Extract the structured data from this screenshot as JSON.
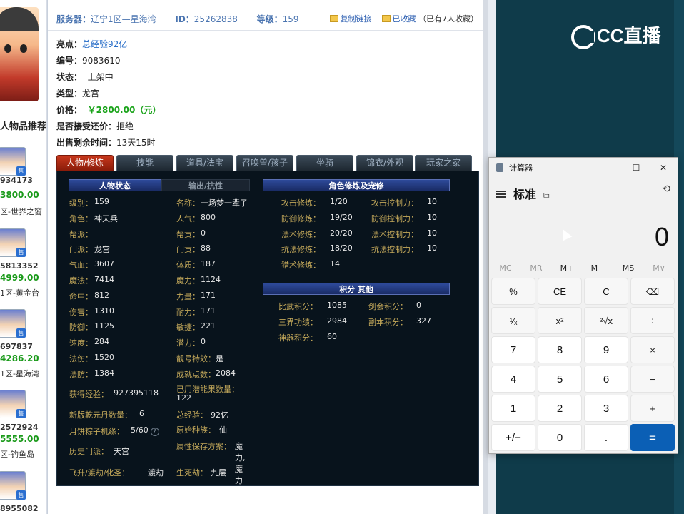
{
  "sidebar": {
    "recommend_title": "人物品推荐",
    "top_id": "934173",
    "top_price": "3800.00",
    "top_server": "区-世界之窗",
    "items": [
      {
        "id": "5813352",
        "price": "4999.00",
        "server": "1区-黄金台",
        "tag": "售"
      },
      {
        "id": "697837",
        "price": "4286.20",
        "server": "1区-星海湾",
        "tag": "售"
      },
      {
        "id": "2572924",
        "price": "5555.00",
        "server": "区-钓鱼岛",
        "tag": "售"
      },
      {
        "id": "8955082",
        "price": "",
        "server": "",
        "tag": "售"
      }
    ]
  },
  "header": {
    "server_label": "服务器：",
    "server_value": "辽宁1区—星海湾",
    "id_label": "ID：",
    "id_value": "25262838",
    "level_label": "等级：",
    "level_value": "159",
    "copy_link": "复制链接",
    "favorited": "已收藏",
    "fav_count": "（已有7人收藏）"
  },
  "info": {
    "highlight_label": "亮点：",
    "highlight_value": "总经验92亿",
    "number_label": "编号：",
    "number_value": "9083610",
    "status_label": "状态：",
    "status_value": "上架中",
    "type_label": "类型：",
    "type_value": "龙宫",
    "price_label": "价格：",
    "price_value": "￥2800.00（元）",
    "counter_label": "是否接受还价：",
    "counter_value": "拒绝",
    "remain_label": "出售剩余时间：",
    "remain_value": "13天15时"
  },
  "tabs": [
    "人物/修炼",
    "技能",
    "道具/法宝",
    "召唤兽/孩子",
    "坐骑",
    "锦衣/外观",
    "玩家之家"
  ],
  "panel": {
    "h_status": "人物状态",
    "h_output": "输出/抗性",
    "h_cultivation": "角色修炼及宠修",
    "h_points": "积分 其他",
    "col1": [
      {
        "k": "级别：",
        "v": "159"
      },
      {
        "k": "角色：",
        "v": "神天兵"
      },
      {
        "k": "帮派：",
        "v": ""
      },
      {
        "k": "门派：",
        "v": "龙宫"
      },
      {
        "k": "气血：",
        "v": "3607"
      },
      {
        "k": "魔法：",
        "v": "7414"
      },
      {
        "k": "命中：",
        "v": "812"
      },
      {
        "k": "伤害：",
        "v": "1310"
      },
      {
        "k": "防御：",
        "v": "1125"
      },
      {
        "k": "速度：",
        "v": "284"
      },
      {
        "k": "法伤：",
        "v": "1520"
      },
      {
        "k": "法防：",
        "v": "1384"
      }
    ],
    "col2": [
      {
        "k": "名称：",
        "v": "一场梦一辈子"
      },
      {
        "k": "人气：",
        "v": "800"
      },
      {
        "k": "帮贡：",
        "v": "0"
      },
      {
        "k": "门贡：",
        "v": "88"
      },
      {
        "k": "体质：",
        "v": "187"
      },
      {
        "k": "魔力：",
        "v": "1124"
      },
      {
        "k": "力量：",
        "v": "171"
      },
      {
        "k": "耐力：",
        "v": "171"
      },
      {
        "k": "敏捷：",
        "v": "221"
      },
      {
        "k": "潜力：",
        "v": "0"
      },
      {
        "k": "靓号特效：",
        "v": "是"
      },
      {
        "k": "成就点数：",
        "v": "2084"
      }
    ],
    "extra_left": [
      {
        "k": "获得经验：",
        "v": "927395118"
      },
      {
        "k": "新版乾元丹数量：",
        "v": "6"
      },
      {
        "k": "月饼粽子机缘：",
        "v": "5/60"
      },
      {
        "k": "历史门派：",
        "v": "天宫"
      },
      {
        "k": "飞升/渡劫/化圣：",
        "v": "渡劫"
      }
    ],
    "extra_right": [
      {
        "k": "已用潜能果数量：",
        "v": "122"
      },
      {
        "k": "总经验：",
        "v": "92亿"
      },
      {
        "k": "原始种族：",
        "v": "仙"
      },
      {
        "k": "属性保存方案：",
        "v": "魔力,魔力"
      },
      {
        "k": "生死劫：",
        "v": "九层"
      }
    ],
    "cult": [
      {
        "k": "攻击修炼：",
        "v": "1/20",
        "k2": "攻击控制力：",
        "v2": "10"
      },
      {
        "k": "防御修炼：",
        "v": "19/20",
        "k2": "防御控制力：",
        "v2": "10"
      },
      {
        "k": "法术修炼：",
        "v": "20/20",
        "k2": "法术控制力：",
        "v2": "10"
      },
      {
        "k": "抗法修炼：",
        "v": "18/20",
        "k2": "抗法控制力：",
        "v2": "10"
      },
      {
        "k": "猎术修炼：",
        "v": "14",
        "k2": "",
        "v2": ""
      }
    ],
    "points": [
      {
        "k": "比武积分：",
        "v": "1085",
        "k2": "剑会积分：",
        "v2": "0"
      },
      {
        "k": "三界功绩：",
        "v": "2984",
        "k2": "副本积分：",
        "v2": "327"
      },
      {
        "k": "神器积分：",
        "v": "60",
        "k2": "",
        "v2": ""
      }
    ]
  },
  "brand": {
    "logo_text": "CC直播"
  },
  "calculator": {
    "title": "计算器",
    "mode": "标准",
    "display": "0",
    "memory": [
      "MC",
      "MR",
      "M+",
      "M−",
      "MS",
      "M∨"
    ],
    "keys": [
      [
        "%",
        "CE",
        "C",
        "⌫"
      ],
      [
        "¹⁄ₓ",
        "x²",
        "²√x",
        "÷"
      ],
      [
        "7",
        "8",
        "9",
        "×"
      ],
      [
        "4",
        "5",
        "6",
        "−"
      ],
      [
        "1",
        "2",
        "3",
        "+"
      ],
      [
        "+/−",
        "0",
        ".",
        "="
      ]
    ]
  }
}
